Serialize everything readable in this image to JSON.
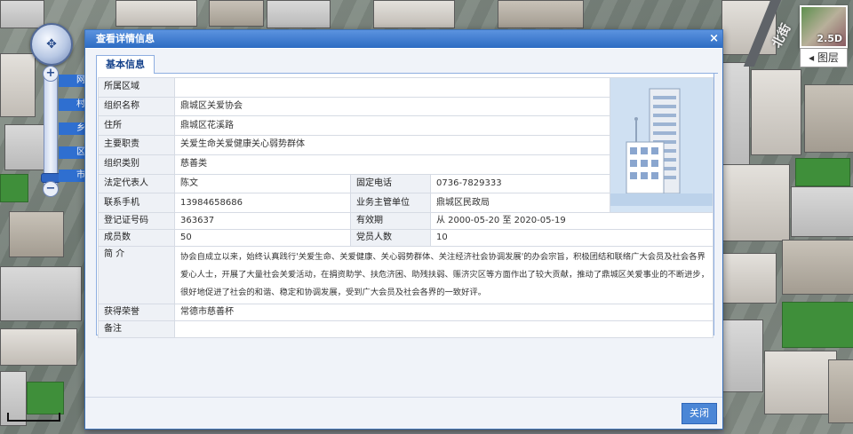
{
  "map": {
    "view_mode": "2.5D",
    "layer_button": "图层",
    "road_label": "北街",
    "zoom_tags": [
      "网",
      "村",
      "乡",
      "区",
      "市"
    ]
  },
  "dialog": {
    "title": "查看详情信息",
    "close_symbol": "×",
    "tab": "基本信息",
    "close_button": "关闭",
    "fields": {
      "region": {
        "label": "所属区域",
        "value": ""
      },
      "org_name": {
        "label": "组织名称",
        "value": "鼎城区关爱协会"
      },
      "address": {
        "label": "住所",
        "value": "鼎城区花溪路"
      },
      "duty": {
        "label": "主要职责",
        "value": "关爱生命关爱健康关心弱势群体"
      },
      "category": {
        "label": "组织类别",
        "value": "慈善类"
      },
      "legal_rep": {
        "label": "法定代表人",
        "value": "陈文"
      },
      "phone": {
        "label": "固定电话",
        "value": "0736-7829333"
      },
      "mobile": {
        "label": "联系手机",
        "value": "13984658686"
      },
      "authority": {
        "label": "业务主管单位",
        "value": "鼎城区民政局"
      },
      "reg_no": {
        "label": "登记证号码",
        "value": "363637"
      },
      "validity": {
        "label": "有效期",
        "value": "从 2000-05-20 至 2020-05-19"
      },
      "members": {
        "label": "成员数",
        "value": "50"
      },
      "party_members": {
        "label": "党员人数",
        "value": "10"
      },
      "intro": {
        "label": "简  介",
        "value": "协会自成立以来，始终认真践行'关爱生命、关爱健康、关心弱势群体、关注经济社会协调发展'的办会宗旨，积极团结和联络广大会员及社会各界爱心人士，开展了大量社会关爱活动，在捐资助学、扶危济困、助残扶弱、赈济灾区等方面作出了较大贡献，推动了鼎城区关爱事业的不断进步，很好地促进了社会的和谐、稳定和协调发展，受到广大会员及社会各界的一致好评。"
      },
      "honors": {
        "label": "获得荣誉",
        "value": "常德市慈善杯"
      },
      "remarks": {
        "label": "备注",
        "value": ""
      }
    }
  },
  "colors": {
    "header_blue": "#2d6cc3",
    "button_blue": "#4b86d6",
    "label_bg": "#eef1f6"
  }
}
